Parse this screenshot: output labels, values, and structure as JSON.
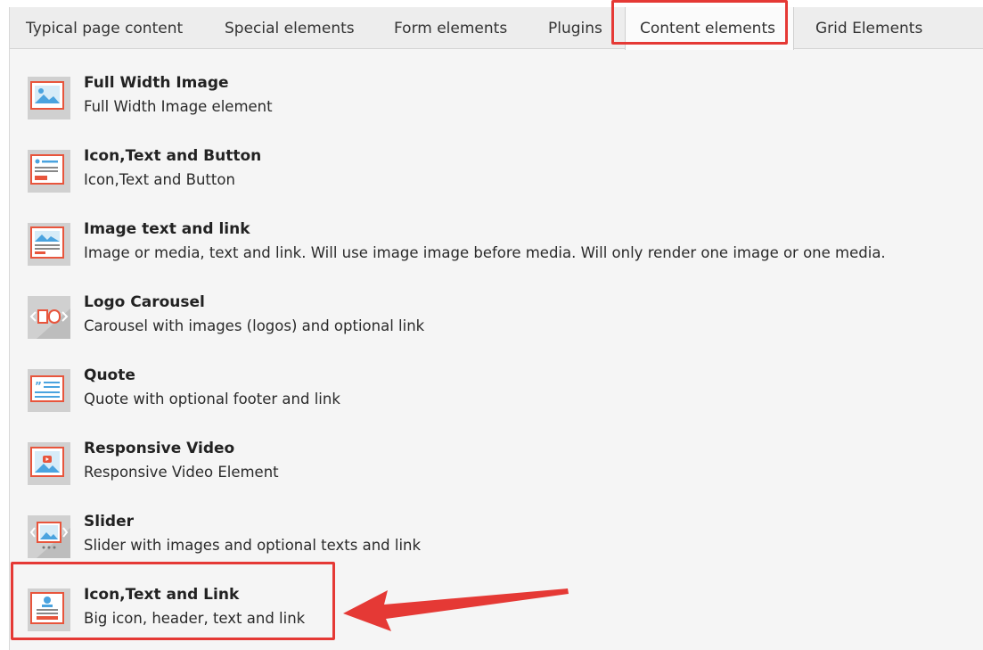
{
  "tabs": [
    {
      "label": "Typical page content",
      "active": false
    },
    {
      "label": "Special elements",
      "active": false
    },
    {
      "label": "Form elements",
      "active": false
    },
    {
      "label": "Plugins",
      "active": false
    },
    {
      "label": "Content elements",
      "active": true
    },
    {
      "label": "Grid Elements",
      "active": false
    }
  ],
  "items": [
    {
      "title": "Full Width Image",
      "desc": "Full Width Image element",
      "icon": "image-icon"
    },
    {
      "title": "Icon,Text and Button",
      "desc": "Icon,Text and Button",
      "icon": "text-button-icon"
    },
    {
      "title": "Image text and link",
      "desc": "Image or media, text and link. Will use image image before media. Will only render one image or one media.",
      "icon": "image-text-icon"
    },
    {
      "title": "Logo Carousel",
      "desc": "Carousel with images (logos) and optional link",
      "icon": "carousel-icon"
    },
    {
      "title": "Quote",
      "desc": "Quote with optional footer and link",
      "icon": "quote-icon"
    },
    {
      "title": "Responsive Video",
      "desc": "Responsive Video Element",
      "icon": "video-icon"
    },
    {
      "title": "Slider",
      "desc": "Slider with images and optional texts and link",
      "icon": "slider-icon"
    },
    {
      "title": "Icon,Text and Link",
      "desc": "Big icon, header, text and link",
      "icon": "icon-text-link-icon"
    }
  ],
  "colors": {
    "accent": "#e53935",
    "icon_frame": "#cfcfcf",
    "icon_blue": "#4aa3df",
    "icon_red": "#e8553c"
  }
}
